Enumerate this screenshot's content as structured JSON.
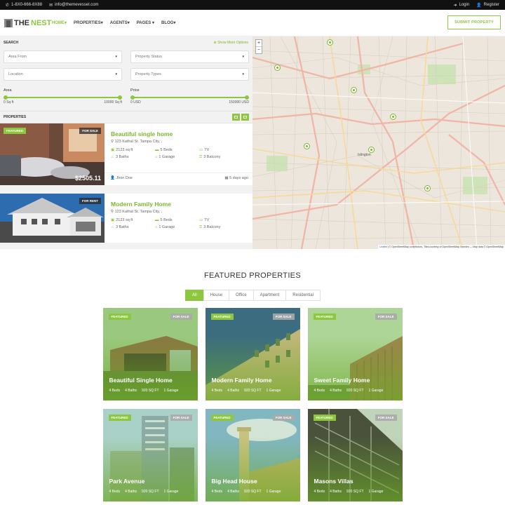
{
  "topbar": {
    "phone": "1-8X0-666-8X88",
    "email": "info@themevessel.com",
    "login": "Login",
    "register": "Register"
  },
  "nav": {
    "logo_a": "THE",
    "logo_b": "NEST",
    "items": [
      "HOME",
      "PROPERTIES",
      "AGENTS",
      "PAGES",
      "BLOG"
    ],
    "submit": "SUBMIT PROPERTY"
  },
  "search": {
    "heading": "SEARCH",
    "more": "Show More Options",
    "selects": [
      "Area From",
      "Property Status",
      "Location",
      "Property Types"
    ],
    "area": {
      "label": "Area",
      "min": "0 Sq ft",
      "max": "10000 Sq ft"
    },
    "price": {
      "label": "Price",
      "min": "0 USD",
      "max": "150000 USD"
    }
  },
  "properties": {
    "heading": "PROPERTIES",
    "cards": [
      {
        "badge_a": "FEATURED",
        "badge_b": "FOR SALE",
        "title": "Beautiful single home",
        "address": "123 Kathal St. Tampa City, ,",
        "feats": [
          "2123 sq ft",
          "5 Beds",
          "TV",
          "3 Baths",
          "1 Garage",
          "3 Balcony"
        ],
        "price": "$2505.11",
        "agent": "Jhon Doe",
        "age": "5 days ago"
      },
      {
        "badge_b": "FOR RENT",
        "title": "Modern Family Home",
        "address": "123 Kathal St. Tampa City, ,",
        "feats": [
          "2123 sq ft",
          "5 Beds",
          "TV",
          "3 Baths",
          "1 Garage",
          "3 Balcony"
        ]
      }
    ]
  },
  "map": {
    "zoom_in": "+",
    "zoom_out": "−",
    "attr_leaflet": "Leaflet",
    "attr_text": " | © OpenStreetMap contributors, Tiles courtesy of OpenStreetMap Sweden — Map data © OpenStreetMap",
    "labels": [
      "Islington"
    ]
  },
  "featured": {
    "title": "FEATURED PROPERTIES",
    "filters": [
      "All",
      "House",
      "Office",
      "Apartment",
      "Residential"
    ],
    "tiles": [
      {
        "name": "Beautiful Single Home",
        "beds": "4 Beds",
        "baths": "4 Baths",
        "area": "920 SQ FT",
        "garage": "1 Garage",
        "badge_a": "FEATURED",
        "badge_b": "FOR SALE"
      },
      {
        "name": "Modern Family Home",
        "beds": "4 Beds",
        "baths": "4 Baths",
        "area": "920 SQ FT",
        "garage": "1 Garage",
        "badge_a": "FEATURED",
        "badge_b": "FOR SALE"
      },
      {
        "name": "Sweet Family Home",
        "beds": "4 Beds",
        "baths": "4 Baths",
        "area": "920 SQ FT",
        "garage": "1 Garage",
        "badge_a": "FEATURED",
        "badge_b": "FOR SALE"
      },
      {
        "name": "Park Avenue",
        "beds": "4 Beds",
        "baths": "4 Baths",
        "area": "920 SQ FT",
        "garage": "1 Garage",
        "badge_a": "FEATURED",
        "badge_b": "FOR SALE"
      },
      {
        "name": "Big Head House",
        "beds": "4 Beds",
        "baths": "4 Baths",
        "area": "920 SQ FT",
        "garage": "1 Garage",
        "badge_a": "FEATURED",
        "badge_b": "FOR SALE"
      },
      {
        "name": "Masons Villas",
        "beds": "4 Beds",
        "baths": "4 Baths",
        "area": "920 SQ FT",
        "garage": "1 Garage",
        "badge_a": "FEATURED",
        "badge_b": "FOR SALE"
      }
    ]
  },
  "colors": {
    "accent": "#8dc63f",
    "dark": "#111111"
  }
}
